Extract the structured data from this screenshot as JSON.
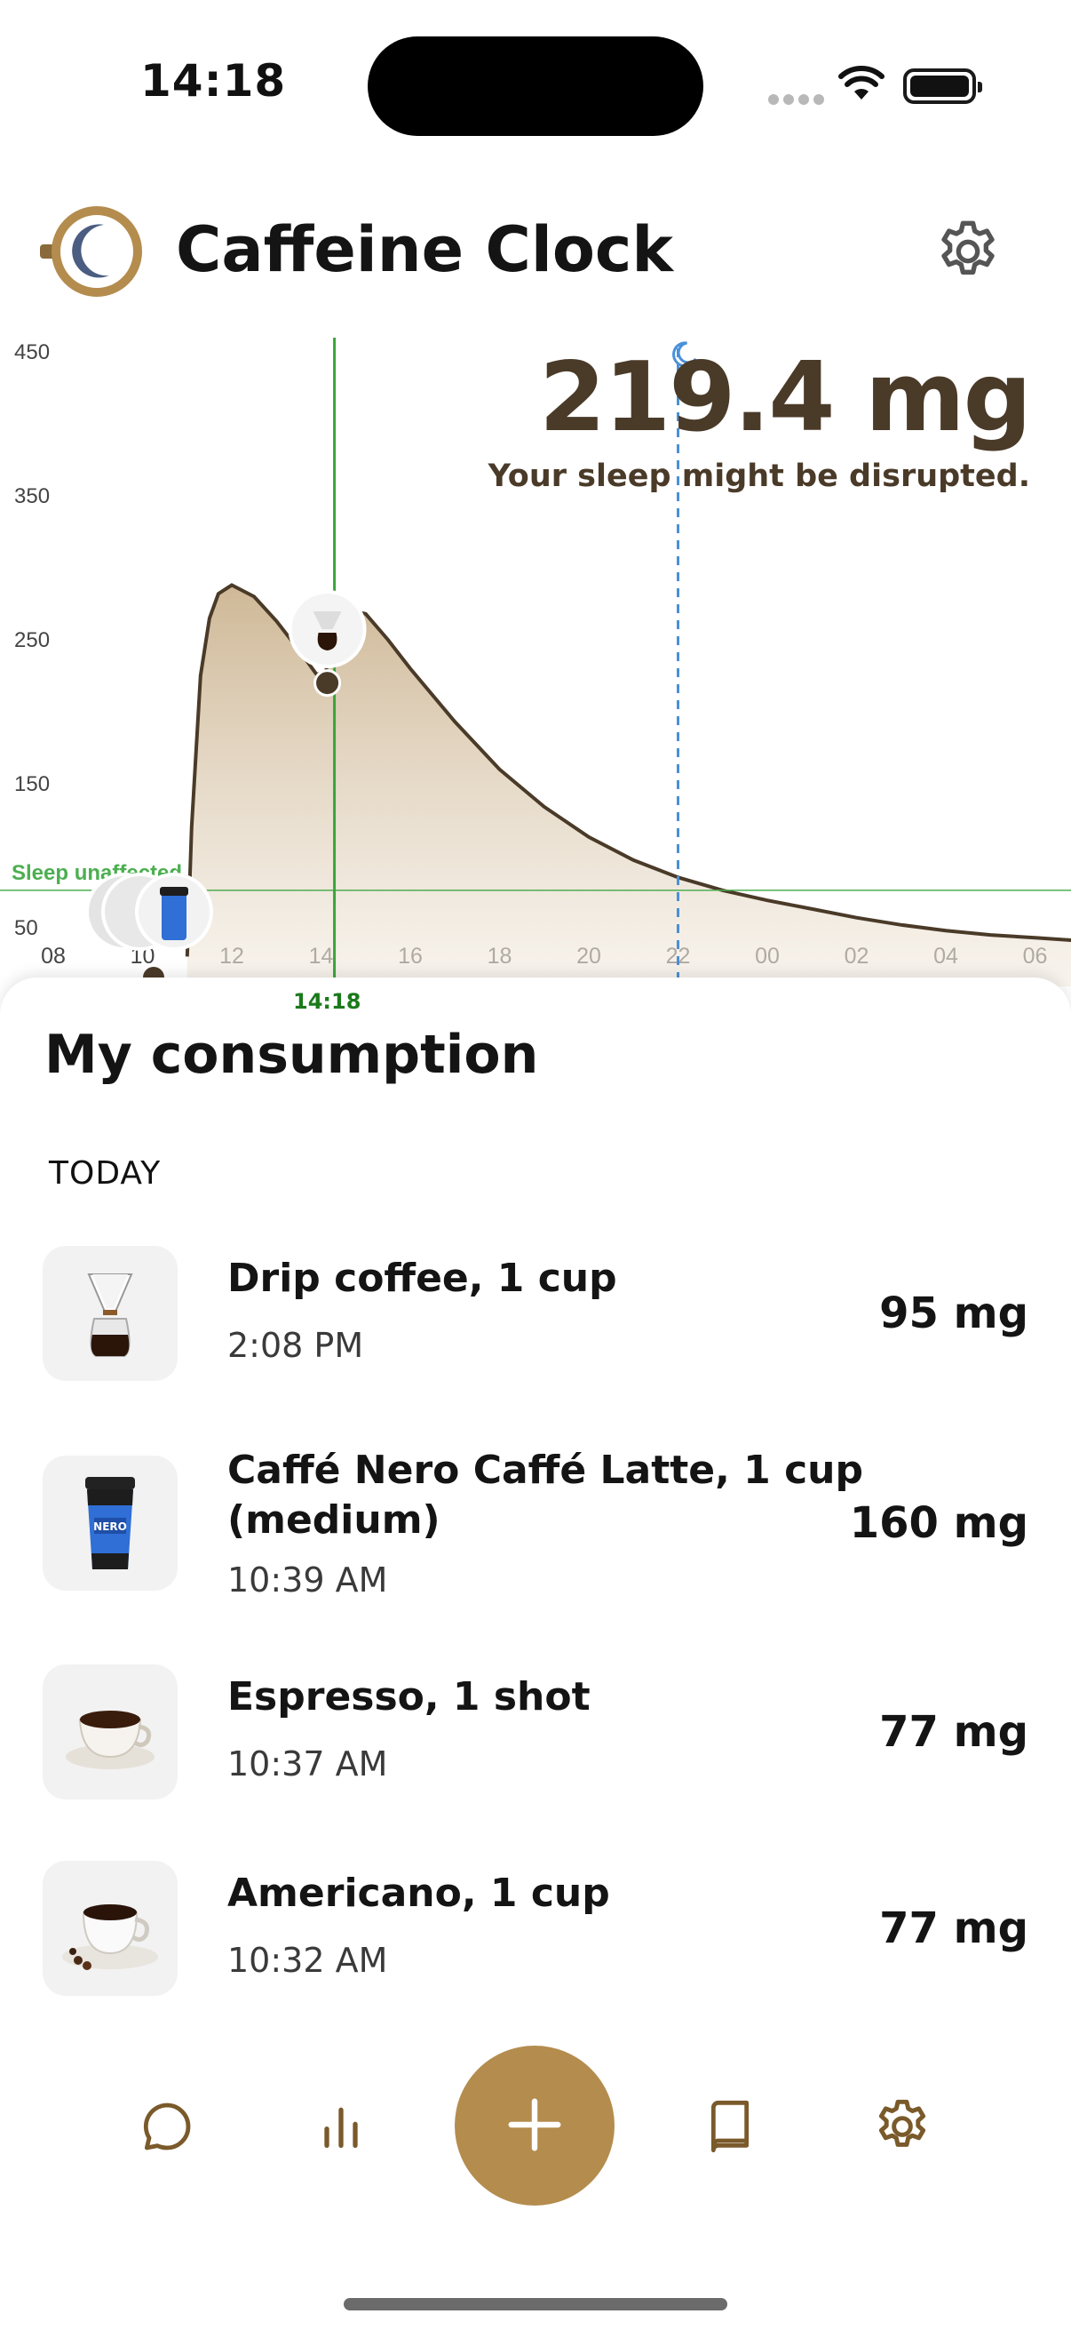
{
  "status_bar": {
    "time": "14:18"
  },
  "header": {
    "title": "Caffeine Clock"
  },
  "summary": {
    "current_value": "219.4 mg",
    "sleep_status": "Your sleep might be disrupted."
  },
  "chart_data": {
    "type": "area",
    "x_ticks": [
      "08",
      "10",
      "12",
      "14",
      "16",
      "18",
      "20",
      "22",
      "00",
      "02",
      "04",
      "06"
    ],
    "y_ticks": [
      "450",
      "350",
      "250",
      "150",
      "50"
    ],
    "ylim": [
      30,
      460
    ],
    "threshold": {
      "value": 76,
      "label": "Sleep unaffected"
    },
    "now": {
      "time": "14:18",
      "value": 219.4
    },
    "bedtime": "22:00",
    "x_hours_from_08": [
      3.0,
      3.1,
      3.3,
      3.5,
      3.7,
      4.0,
      4.5,
      5.0,
      5.5,
      5.9,
      6.1,
      6.3,
      6.6,
      7.0,
      7.5,
      8.0,
      9.0,
      10.0,
      11.0,
      12.0,
      13.0,
      14.0,
      15.0,
      16.0,
      17.0,
      18.0,
      19.0,
      20.0,
      21.0,
      22.0,
      23.0
    ],
    "y_values": [
      30,
      120,
      225,
      265,
      282,
      288,
      280,
      263,
      243,
      226,
      227,
      254,
      271,
      268,
      250,
      230,
      193,
      160,
      134,
      113,
      97,
      85,
      76,
      69,
      63,
      57,
      52,
      48,
      45,
      43,
      41
    ]
  },
  "consumption": {
    "title": "My consumption",
    "section": "TODAY",
    "items": [
      {
        "name": "Drip coffee, 1 cup",
        "time": "2:08 PM",
        "mg": "95 mg",
        "icon": "drip-coffee-icon"
      },
      {
        "name": "Caffé Nero Caffé Latte, 1 cup",
        "name2": "(medium)",
        "time": "10:39 AM",
        "mg": "160 mg",
        "icon": "latte-cup-icon"
      },
      {
        "name": "Espresso, 1 shot",
        "time": "10:37 AM",
        "mg": "77 mg",
        "icon": "espresso-icon"
      },
      {
        "name": "Americano, 1 cup",
        "time": "10:32 AM",
        "mg": "77 mg",
        "icon": "americano-icon"
      }
    ]
  },
  "tab_bar": {
    "tabs": [
      {
        "icon": "chat-bubble-icon"
      },
      {
        "icon": "bar-chart-icon"
      },
      {
        "icon": "plus-icon"
      },
      {
        "icon": "book-icon"
      },
      {
        "icon": "gear-icon"
      }
    ]
  },
  "colors": {
    "accent": "#b48c4e",
    "curve": "#4a3a28",
    "threshold": "#4caf50",
    "now_line": "#3aa53a",
    "bedtime_line": "#4a90d9"
  }
}
